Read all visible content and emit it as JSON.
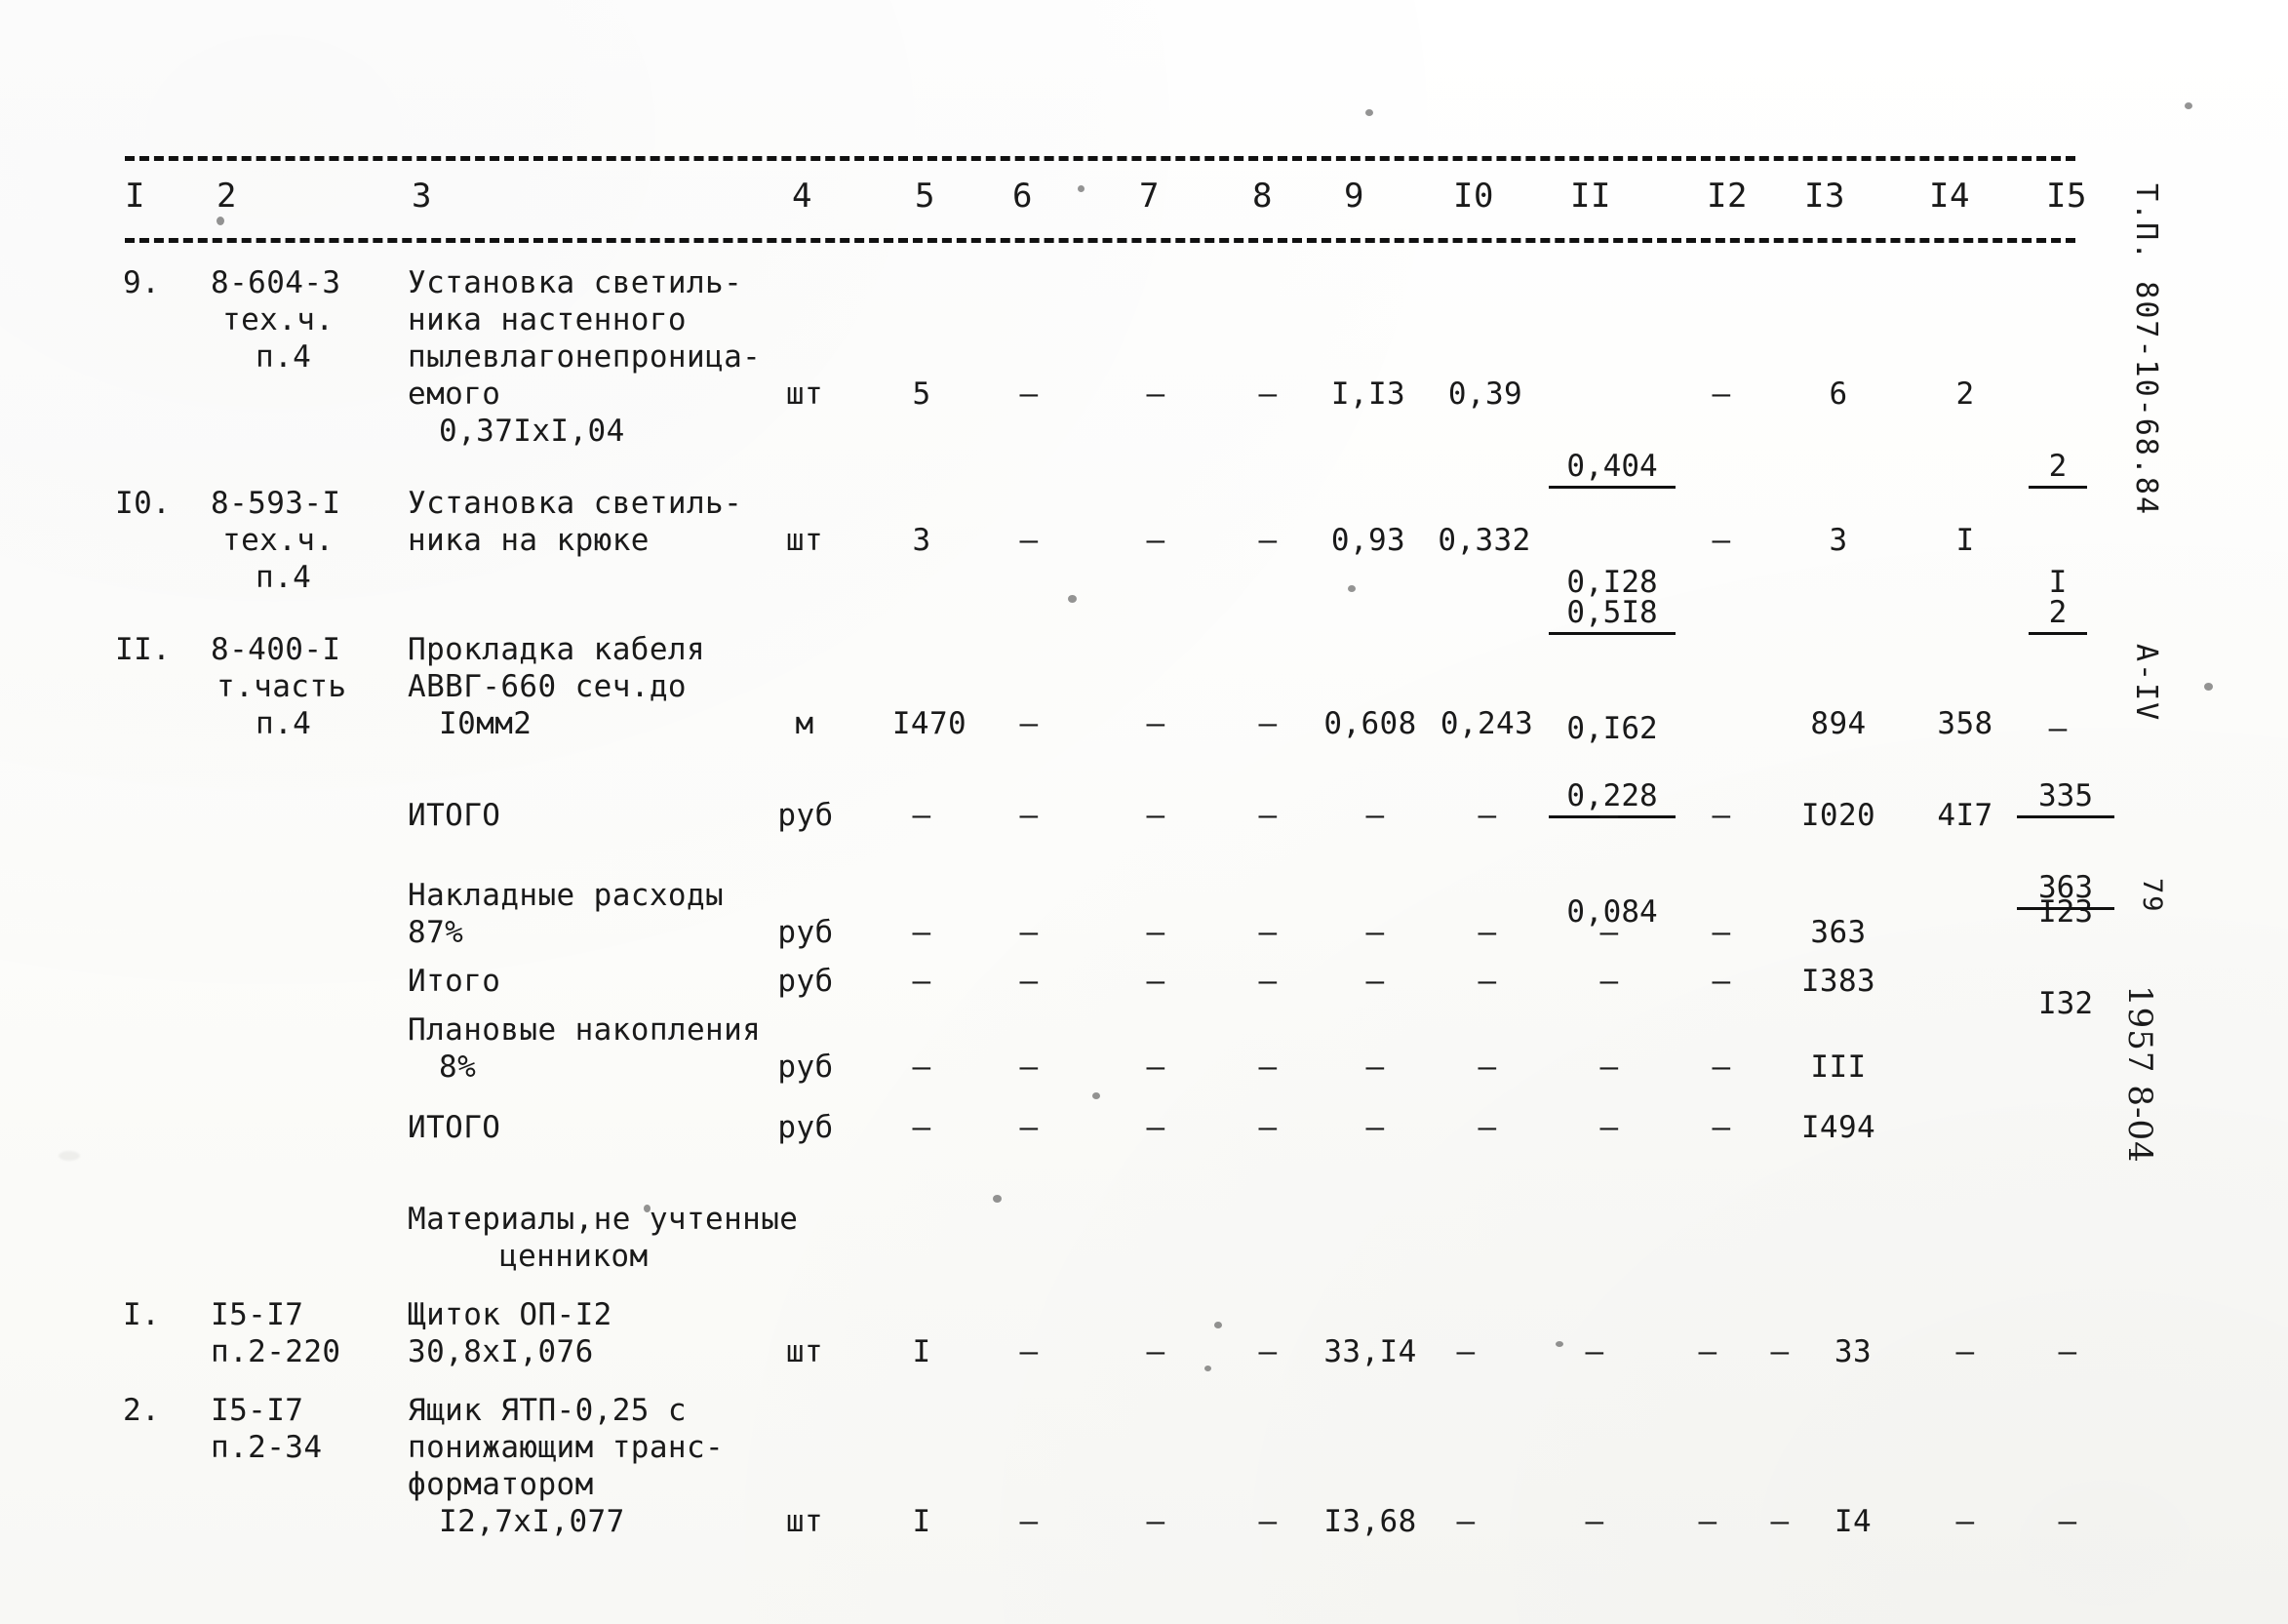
{
  "document": {
    "kind": "scanned-estimate-sheet",
    "language": "ru"
  },
  "table": {
    "column_headers": [
      "I",
      "2",
      "3",
      "4",
      "5",
      "6",
      "7",
      "8",
      "9",
      "I0",
      "II",
      "I2",
      "I3",
      "I4",
      "I5"
    ],
    "rows": [
      {
        "no": "9.",
        "code_lines": [
          "8-604-3",
          "тех.ч.",
          "п.4"
        ],
        "name_lines": [
          "Установка светиль-",
          "ника настенного",
          "пылевлагонепроница-",
          "емого",
          "0,37IxI,04"
        ],
        "unit": "шт",
        "c5": "5",
        "c6": "–",
        "c7": "–",
        "c8": "–",
        "c9": "I,I3",
        "c10": "0,39",
        "c11_num": "0,404",
        "c11_den": "0,I28",
        "c12": "–",
        "c13": "6",
        "c14": "2",
        "c15_num": "2",
        "c15_den": "I"
      },
      {
        "no": "I0.",
        "code_lines": [
          "8-593-I",
          "тех.ч.",
          "п.4"
        ],
        "name_lines": [
          "Установка светиль-",
          "ника на крюке"
        ],
        "unit": "шт",
        "c5": "3",
        "c6": "–",
        "c7": "–",
        "c8": "–",
        "c9": "0,93",
        "c10": "0,332",
        "c11_num": "0,5I8",
        "c11_den": "0,I62",
        "c12": "–",
        "c13": "3",
        "c14": "I",
        "c15_num": "2",
        "c15_den": "–"
      },
      {
        "no": "II.",
        "code_lines": [
          "8-400-I",
          "т.часть",
          "п.4"
        ],
        "name_lines": [
          "Прокладка кабеля",
          "АВВГ-660 сеч.до",
          "I0мм2"
        ],
        "unit": "м",
        "c5": "I470",
        "c6": "–",
        "c7": "–",
        "c8": "–",
        "c9": "0,608",
        "c10": "0,243",
        "c11_num": "0,228",
        "c11_den": "0,084",
        "c12": "",
        "c13": "894",
        "c14": "358",
        "c15_num": "335",
        "c15_den": "I23"
      }
    ],
    "summary_rows": [
      {
        "name_lines": [
          "ИТОГО"
        ],
        "unit": "руб",
        "c5": "–",
        "c6": "–",
        "c7": "–",
        "c8": "–",
        "c9": "–",
        "c10": "–",
        "c11": "–",
        "c12": "–",
        "c13": "I020",
        "c14": "4I7",
        "c15_num": "363",
        "c15_den": "I32"
      },
      {
        "name_lines": [
          "Накладные расходы",
          "87%"
        ],
        "unit": "руб",
        "c5": "–",
        "c6": "–",
        "c7": "–",
        "c8": "–",
        "c9": "–",
        "c10": "–",
        "c11": "–",
        "c12": "–",
        "c13": "363",
        "c14": "",
        "c15_num": "",
        "c15_den": ""
      },
      {
        "name_lines": [
          "Итого"
        ],
        "unit": "руб",
        "c5": "–",
        "c6": "–",
        "c7": "–",
        "c8": "–",
        "c9": "–",
        "c10": "–",
        "c11": "–",
        "c12": "–",
        "c13": "I383",
        "c14": "",
        "c15_num": "",
        "c15_den": ""
      },
      {
        "name_lines": [
          "Плановые накопления",
          "8%"
        ],
        "unit": "руб",
        "c5": "–",
        "c6": "–",
        "c7": "–",
        "c8": "–",
        "c9": "–",
        "c10": "–",
        "c11": "–",
        "c12": "–",
        "c13": "III",
        "c14": "",
        "c15_num": "",
        "c15_den": ""
      },
      {
        "name_lines": [
          "ИТОГО"
        ],
        "unit": "руб",
        "c5": "–",
        "c6": "–",
        "c7": "–",
        "c8": "–",
        "c9": "–",
        "c10": "–",
        "c11": "–",
        "c12": "–",
        "c13": "I494",
        "c14": "",
        "c15_num": "",
        "c15_den": ""
      }
    ],
    "section_heading": {
      "line1": "Материалы,не учтенные",
      "line2": "ценником"
    },
    "material_rows": [
      {
        "no": "I.",
        "code_lines": [
          "I5-I7",
          "п.2-220"
        ],
        "name_lines": [
          "Щиток ОП-I2",
          "30,8xI,076"
        ],
        "unit": "шт",
        "c5": "I",
        "c6": "–",
        "c7": "–",
        "c8": "–",
        "c9": "33,I4",
        "c10": "–",
        "c11": "–",
        "c12": "–",
        "c13_dash": "–",
        "c13": "33",
        "c14": "–",
        "c15": "–"
      },
      {
        "no": "2.",
        "code_lines": [
          "I5-I7",
          "п.2-34"
        ],
        "name_lines": [
          "Ящик ЯТП-0,25 с",
          "понижающим транс-",
          "форматором",
          "I2,7xI,077"
        ],
        "unit": "шт",
        "c5": "I",
        "c6": "–",
        "c7": "–",
        "c8": "–",
        "c9": "I3,68",
        "c10": "–",
        "c11": "–",
        "c12": "–",
        "c13_dash": "–",
        "c13": "I4",
        "c14": "–",
        "c15": "–"
      }
    ]
  },
  "margin": {
    "project_code": "Т.П. 807-10-68.84",
    "sheet_code": "А-IV",
    "page_number": "79",
    "stamp_number": "1957 8-04"
  }
}
